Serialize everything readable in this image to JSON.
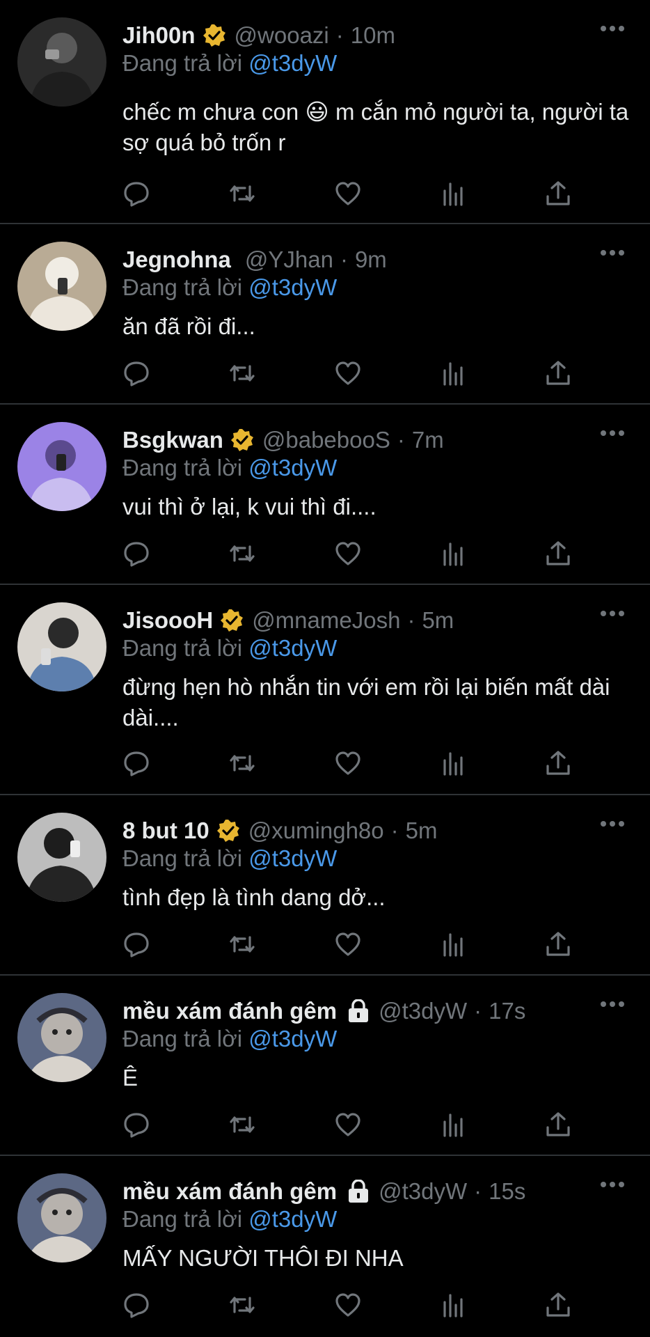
{
  "tweets": [
    {
      "name": "Jih00n",
      "verified": true,
      "locked": false,
      "handle": "@wooazi",
      "time": "10m",
      "reply_prefix": "Đang trả lời ",
      "reply_to": "@t3dyW",
      "text_before_emoji": "chếc m chưa con ",
      "emoji": "😃",
      "text_after_emoji": "  m cắn mỏ người ta, người ta sợ quá bỏ trốn r",
      "avatar_color": "#3a3a3a"
    },
    {
      "name": "Jegnohna",
      "verified": false,
      "locked": false,
      "handle": "@YJhan",
      "time": "9m",
      "reply_prefix": "Đang trả lời ",
      "reply_to": "@t3dyW",
      "text": "ăn đã rồi đi...",
      "avatar_color": "#cbbfae"
    },
    {
      "name": "Bsgkwan",
      "verified": true,
      "locked": false,
      "handle": "@babebooS",
      "time": "7m",
      "reply_prefix": "Đang trả lời ",
      "reply_to": "@t3dyW",
      "text": "vui thì ở lại, k vui thì đi....",
      "avatar_color": "#8e76d9"
    },
    {
      "name": "JisoooH",
      "verified": true,
      "locked": false,
      "handle": "@mnameJosh",
      "time": "5m",
      "reply_prefix": "Đang trả lời ",
      "reply_to": "@t3dyW",
      "text": "đừng hẹn hò nhắn tin với em rồi lại biến mất dài dài....",
      "avatar_color": "#6f8fb3"
    },
    {
      "name": "8 but 10",
      "verified": true,
      "locked": false,
      "handle": "@xumingh8o",
      "time": "5m",
      "reply_prefix": "Đang trả lời ",
      "reply_to": "@t3dyW",
      "text": "tình đẹp là tình dang dở...",
      "avatar_color": "#5a5a5a"
    },
    {
      "name": "mều xám đánh gêm",
      "verified": false,
      "locked": true,
      "handle": "@t3dyW",
      "time": "17s",
      "reply_prefix": "Đang trả lời ",
      "reply_to": "@t3dyW",
      "text": "Ê",
      "avatar_color": "#6b7590"
    },
    {
      "name": "mều xám đánh gêm",
      "verified": false,
      "locked": true,
      "handle": "@t3dyW",
      "time": "15s",
      "reply_prefix": "Đang trả lời ",
      "reply_to": "@t3dyW",
      "text": "MẤY NGƯỜI THÔI ĐI NHA",
      "avatar_color": "#6b7590"
    }
  ],
  "colors": {
    "background": "#000000",
    "primary_text": "#e7e9ea",
    "secondary_text": "#71767b",
    "mention": "#4a99e9",
    "verified_badge": "#e8b630",
    "divider": "#2f3336"
  },
  "icons": {
    "reply": "reply-icon",
    "retweet": "retweet-icon",
    "like": "like-icon",
    "views": "views-icon",
    "share": "share-icon",
    "more": "more-icon",
    "verified": "verified-badge-icon",
    "lock": "lock-icon"
  }
}
